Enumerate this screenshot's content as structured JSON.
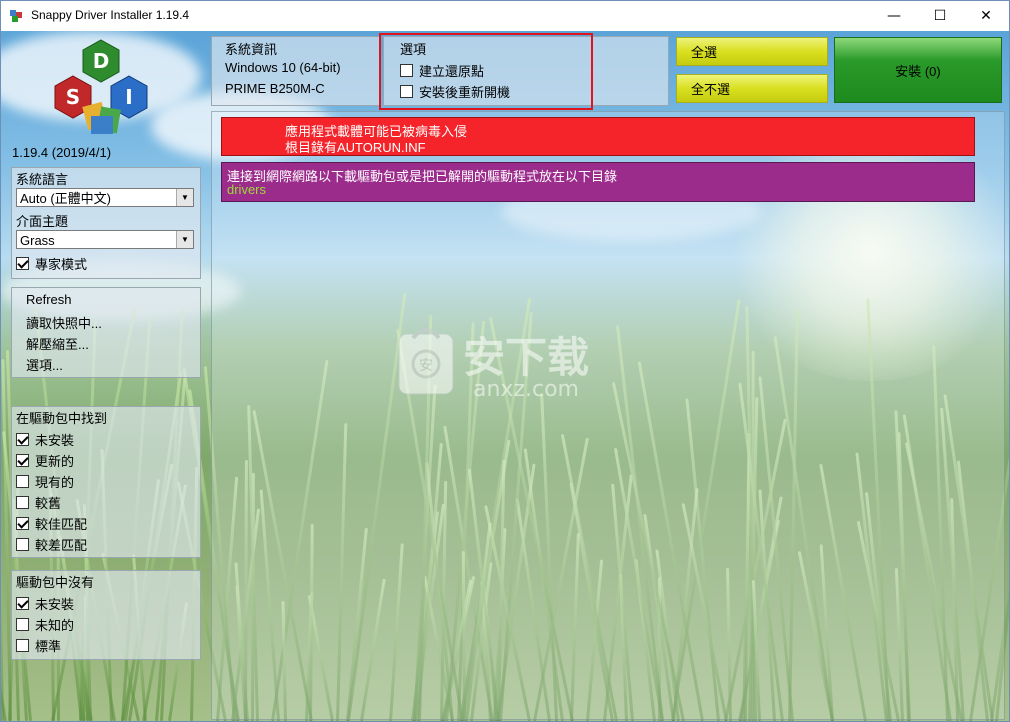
{
  "window": {
    "title": "Snappy Driver Installer 1.19.4",
    "minimize": "—",
    "maximize": "☐",
    "close": "✕"
  },
  "logo": {
    "letters": [
      "D",
      "S",
      "I"
    ]
  },
  "version": "1.19.4 (2019/4/1)",
  "settings": {
    "language_label": "系統語言",
    "language_value": "Auto (正體中文)",
    "theme_label": "介面主題",
    "theme_value": "Grass",
    "expert_mode_label": "專家模式"
  },
  "menu": {
    "refresh": "Refresh",
    "load_snapshot": "讀取快照中...",
    "extract_to": "解壓縮至...",
    "options": "選項..."
  },
  "found_in_pack": {
    "title": "在驅動包中找到",
    "items": [
      {
        "label": "未安裝",
        "checked": true
      },
      {
        "label": "更新的",
        "checked": true
      },
      {
        "label": "現有的",
        "checked": false
      },
      {
        "label": "較舊",
        "checked": false
      },
      {
        "label": "較佳匹配",
        "checked": true
      },
      {
        "label": "較差匹配",
        "checked": false
      }
    ]
  },
  "not_in_pack": {
    "title": "驅動包中沒有",
    "items": [
      {
        "label": "未安裝",
        "checked": true
      },
      {
        "label": "未知的",
        "checked": false
      },
      {
        "label": "標準",
        "checked": false
      }
    ]
  },
  "sysinfo": {
    "title": "系統資訊",
    "os": "Windows 10 (64-bit)",
    "board": "PRIME B250M-C"
  },
  "options": {
    "title": "選項",
    "create_restore_point": "建立還原點",
    "restart_after_install": "安裝後重新開機"
  },
  "buttons": {
    "select_all": "全選",
    "select_none": "全不選",
    "install": "安裝 (0)"
  },
  "alerts": {
    "virus_line1": "應用程式載體可能已被病毒入侵",
    "virus_line2": "根目錄有AUTORUN.INF",
    "download_line1": "連接到網際網路以下載驅動包或是把已解開的驅動程式放在以下目錄",
    "download_line2": "drivers"
  },
  "watermark": {
    "text": "安下载",
    "url": "anxz.com"
  },
  "colors": {
    "alert_red": "#f4242a",
    "alert_purple": "#9c2c8c",
    "drivers_green": "#9ddc3a",
    "install_green": "#1d8a1d",
    "highlight_red": "#e0141c"
  }
}
